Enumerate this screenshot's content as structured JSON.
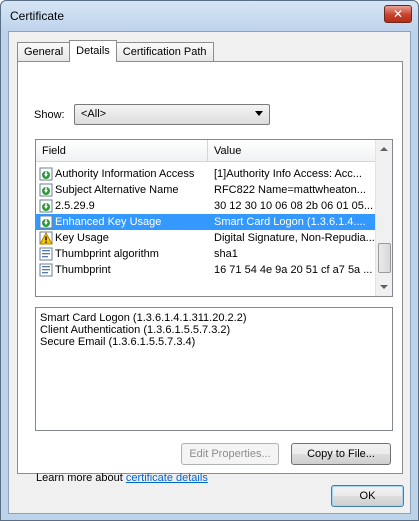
{
  "window": {
    "title": "Certificate",
    "close_label": "✕"
  },
  "tabs": [
    {
      "label": "General",
      "active": false
    },
    {
      "label": "Details",
      "active": true
    },
    {
      "label": "Certification Path",
      "active": false
    }
  ],
  "show": {
    "label": "Show:",
    "selected": "<All>"
  },
  "list": {
    "headers": {
      "field": "Field",
      "value": "Value"
    },
    "rows": [
      {
        "field": "Authority Information Access",
        "value": "[1]Authority Info Access: Acc...",
        "icon": "extension-icon",
        "selected": false
      },
      {
        "field": "Subject Alternative Name",
        "value": "RFC822 Name=mattwheaton...",
        "icon": "extension-icon",
        "selected": false
      },
      {
        "field": "2.5.29.9",
        "value": "30 12 30 10 06 08 2b 06 01 05...",
        "icon": "extension-icon",
        "selected": false
      },
      {
        "field": "Enhanced Key Usage",
        "value": "Smart Card Logon (1.3.6.1.4....",
        "icon": "extension-icon",
        "selected": true
      },
      {
        "field": "Key Usage",
        "value": "Digital Signature, Non-Repudia...",
        "icon": "warning-icon",
        "selected": false
      },
      {
        "field": "Thumbprint algorithm",
        "value": "sha1",
        "icon": "property-icon",
        "selected": false
      },
      {
        "field": "Thumbprint",
        "value": "16 71 54 4e 9a 20 51 cf a7 5a ...",
        "icon": "property-icon",
        "selected": false
      }
    ]
  },
  "detail": {
    "lines": [
      "Smart Card Logon (1.3.6.1.4.1.311.20.2.2)",
      "Client Authentication (1.3.6.1.5.5.7.3.2)",
      "Secure Email (1.3.6.1.5.5.7.3.4)"
    ]
  },
  "buttons": {
    "edit_properties": "Edit Properties...",
    "copy_to_file": "Copy to File...",
    "ok": "OK"
  },
  "learn_more": {
    "prefix": "Learn more about ",
    "link": "certificate details"
  }
}
